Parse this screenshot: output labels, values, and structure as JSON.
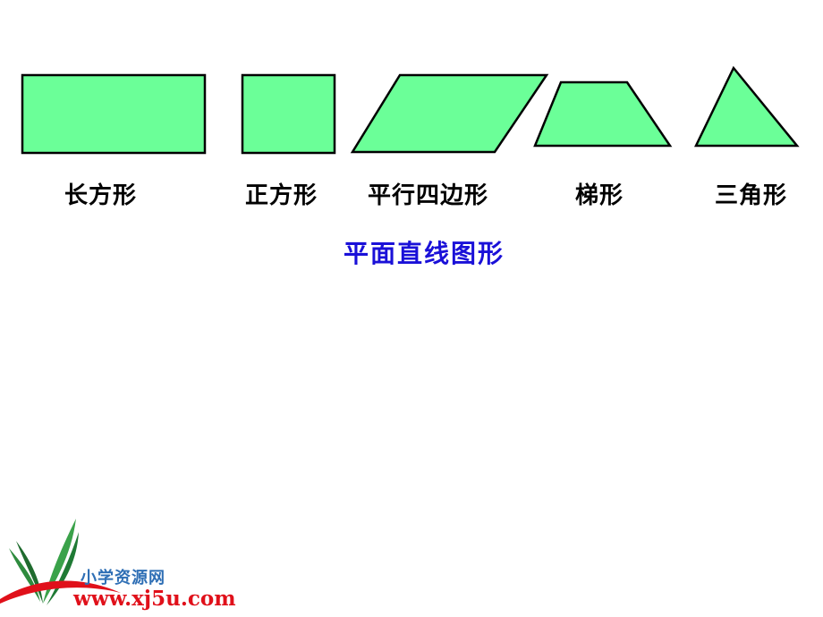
{
  "slide": {
    "shapes": [
      {
        "type": "rectangle",
        "label": "长方形"
      },
      {
        "type": "square",
        "label": "正方形"
      },
      {
        "type": "parallelogram",
        "label": "平行四边形"
      },
      {
        "type": "trapezoid",
        "label": "梯形"
      },
      {
        "type": "triangle",
        "label": "三角形"
      }
    ],
    "subtitle": "平面直线图形",
    "colors": {
      "shape_fill": "#6bff98",
      "shape_stroke": "#000000",
      "subtitle": "#1a10d8"
    }
  },
  "watermark": {
    "site_name": "小学资源网",
    "url": "www.xj5u.com"
  }
}
